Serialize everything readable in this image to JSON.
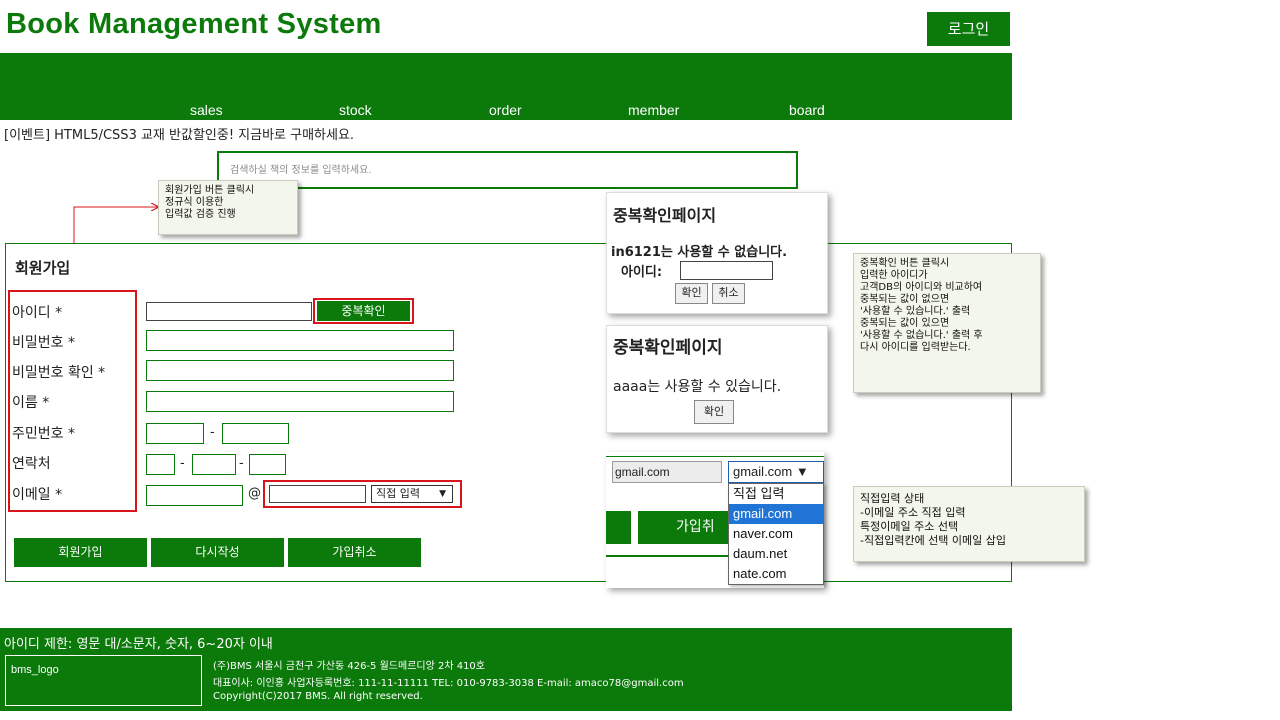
{
  "header": {
    "title": "Book Management System",
    "login_label": "로그인"
  },
  "nav": [
    "sales",
    "stock",
    "order",
    "member",
    "board"
  ],
  "event_text": "[이벤트] HTML5/CSS3 교재 반값할인중! 지금바로 구매하세요.",
  "search": {
    "placeholder": "검색하실 책의 정보를 입력하세요."
  },
  "notes": {
    "signup": "회원가입 버튼 클릭시\n정규식 이용한\n입력값 검증 진행",
    "dupcheck": "중복확인 버튼 클릭시\n입력한 아이디가\n고객DB의 아이디와 비교하여\n중복되는 값이 없으면\n'사용할 수 있습니다.' 출력\n중복되는 값이 있으면\n'사용할 수 없습니다.' 출력 후\n다시 아이디를 입력받는다.",
    "email": "직접입력 상태\n-이메일 주소 직접 입력\n특정이메일 주소 선택\n-직접입력칸에 선택 이메일 삽입"
  },
  "form": {
    "title": "회원가입",
    "labels": {
      "id": "아이디 *",
      "password": "비밀번호 *",
      "password_confirm": "비밀번호 확인 *",
      "name": "이름 *",
      "ssn": "주민번호 *",
      "phone": "연락처",
      "email": "이메일 *"
    },
    "dup_check_label": "중복확인",
    "email_at": "@",
    "email_select": "직접 입력",
    "dash": "-",
    "buttons": {
      "signup": "회원가입",
      "reset": "다시작성",
      "cancel": "가입취소"
    }
  },
  "popup_fail": {
    "title": "중복확인페이지",
    "message": "in6121는 사용할 수 없습니다.",
    "id_label": "아이디:",
    "ok": "확인",
    "cancel": "취소"
  },
  "popup_ok": {
    "title": "중복확인페이지",
    "message": "aaaa는 사용할 수 있습니다.",
    "ok": "확인"
  },
  "email_demo": {
    "input_value": "gmail.com",
    "select_value": "gmail.com ▼",
    "options": [
      "직접 입력",
      "gmail.com",
      "naver.com",
      "daum.net",
      "nate.com"
    ],
    "selected_index": 1,
    "join_partial": "가입취"
  },
  "footer": {
    "notice": "아이디 제한: 영문 대/소문자, 숫자, 6~20자 이내",
    "logo": "bms_logo",
    "address": "(주)BMS 서울시 금천구 가산동 426-5 월드메르디앙 2차 410호",
    "ceo": "대표이사: 이인홍 사업자등록번호: 111-11-11111 TEL: 010-9783-3038 E-mail: amaco78@gmail.com",
    "copyright": "Copyright(C)2017 BMS. All right reserved."
  },
  "colors": {
    "brand_green": "#0b7a0b",
    "highlight_red": "#d9141b",
    "note_bg": "#f3f6ea",
    "selected_blue": "#1f74d6"
  }
}
